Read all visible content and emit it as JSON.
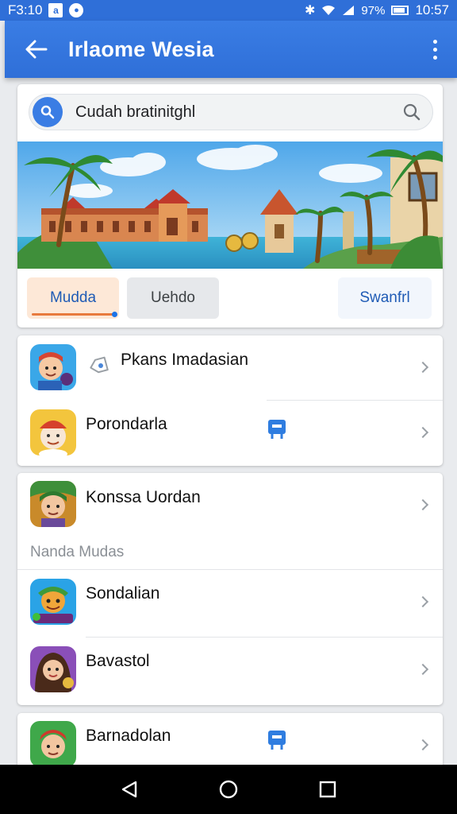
{
  "status_bar": {
    "time_left": "F3:10",
    "box_glyph": "a",
    "battery_text": "97%",
    "clock": "10:57"
  },
  "app_bar": {
    "title": "Irlaome Wesia"
  },
  "search": {
    "value": "Cudah bratinitghl"
  },
  "chips": [
    {
      "label": "Mudda"
    },
    {
      "label": "Uehdo"
    },
    {
      "label": "Swanfrl"
    }
  ],
  "list_a": [
    {
      "label": "Pkans Imadasian"
    },
    {
      "label": "Porondarla"
    }
  ],
  "list_b": {
    "first": {
      "label": "Konssa Uordan"
    },
    "section_label": "Nanda  Mudas",
    "items": [
      {
        "label": "Sondalian"
      },
      {
        "label": "Bavastol"
      }
    ]
  },
  "list_c": [
    {
      "label": "Barnadolan"
    }
  ],
  "colors": {
    "primary": "#2f6fd8",
    "accent_orange": "#e87a3d",
    "chip_active_bg": "#fde8d7"
  },
  "icons": [
    "back-arrow-icon",
    "more-vert-icon",
    "search-icon",
    "magnifier-icon",
    "chevron-right-icon",
    "tag-icon",
    "bookmark-icon",
    "back-nav-icon",
    "home-nav-icon",
    "recents-nav-icon"
  ]
}
